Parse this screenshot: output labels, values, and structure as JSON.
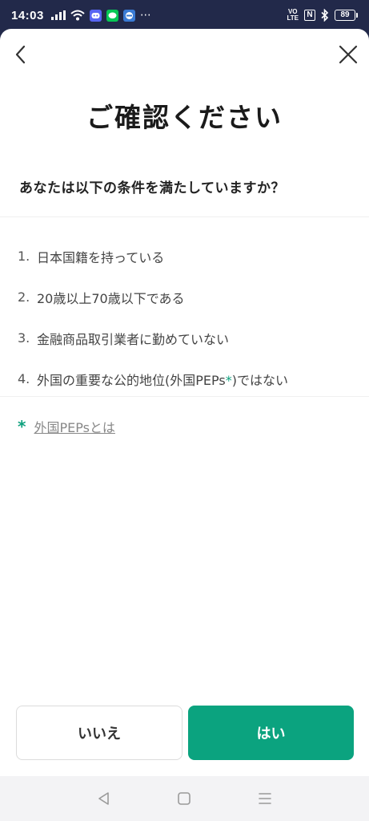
{
  "status_bar": {
    "time": "14:03",
    "apps": [
      {
        "name": "discord",
        "color": "#5865f2"
      },
      {
        "name": "line",
        "color": "#06c755"
      },
      {
        "name": "app",
        "color": "#3a7bd5"
      }
    ],
    "more": "⋯",
    "volte_top": "VO",
    "volte_bottom": "LTE",
    "nfc": "N",
    "battery": "89"
  },
  "dialog": {
    "title": "ご確認ください",
    "question": "あなたは以下の条件を満たしていますか？",
    "conditions": [
      {
        "num": "1.",
        "text": "日本国籍を持っている"
      },
      {
        "num": "2.",
        "text": "20歳以上70歳以下である"
      },
      {
        "num": "3.",
        "text": "金融商品取引業者に勤めていない"
      },
      {
        "num": "4.",
        "text_before": "外国の重要な公的地位(外国PEPs",
        "star": "*",
        "text_after": ")ではない"
      }
    ],
    "peps_link": {
      "star": "*",
      "text": "外国PEPsとは"
    },
    "no_label": "いいえ",
    "yes_label": "はい"
  },
  "colors": {
    "accent": "#0ba37f",
    "status_bar": "#22294a"
  },
  "icons": [
    "back-icon",
    "close-icon",
    "nav-back-icon",
    "nav-home-icon",
    "nav-menu-icon"
  ]
}
